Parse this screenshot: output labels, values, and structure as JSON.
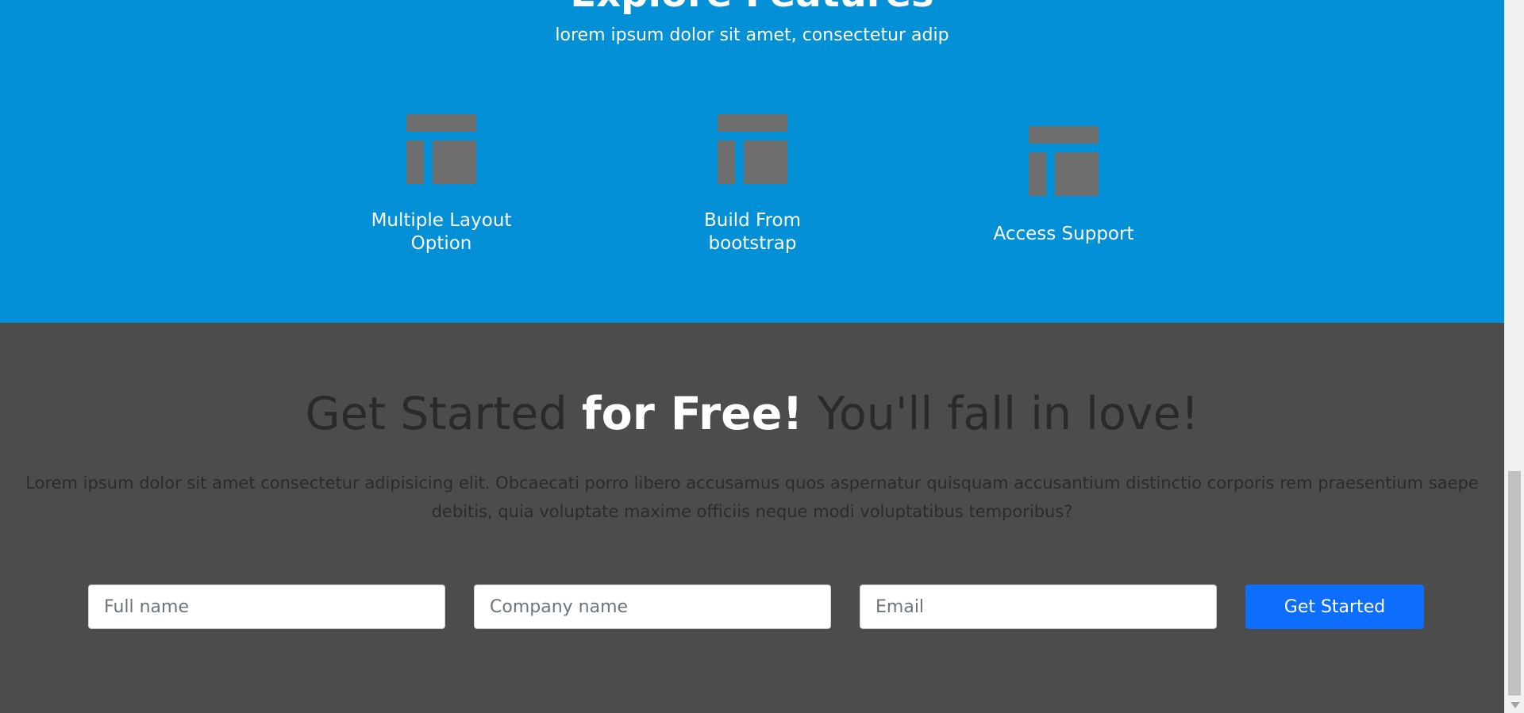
{
  "features": {
    "title": "Explore Features",
    "subtitle": "lorem ipsum dolor sit amet, consectetur adip",
    "items": [
      {
        "label": "Multiple Layout\nOption",
        "icon": "layout-icon"
      },
      {
        "label": "Build From\nbootstrap",
        "icon": "layout-icon"
      },
      {
        "label": "Access Support",
        "icon": "layout-icon"
      }
    ],
    "background_color": "#0390d6",
    "icon_color": "#6e6e6e"
  },
  "get_started": {
    "heading_part1": "Get Started",
    "heading_highlight": "for Free!",
    "heading_part2": "You'll fall in love!",
    "description": "Lorem ipsum dolor sit amet consectetur adipisicing elit. Obcaecati porro libero accusamus quos aspernatur quisquam accusantium distinctio corporis rem praesentium saepe debitis, quia voluptate maxime officiis neque modi voluptatibus temporibus?",
    "background_color": "#4c4c4c",
    "form": {
      "full_name_placeholder": "Full name",
      "company_placeholder": "Company name",
      "email_placeholder": "Email",
      "submit_label": "Get Started",
      "button_color": "#0d6efd"
    }
  }
}
